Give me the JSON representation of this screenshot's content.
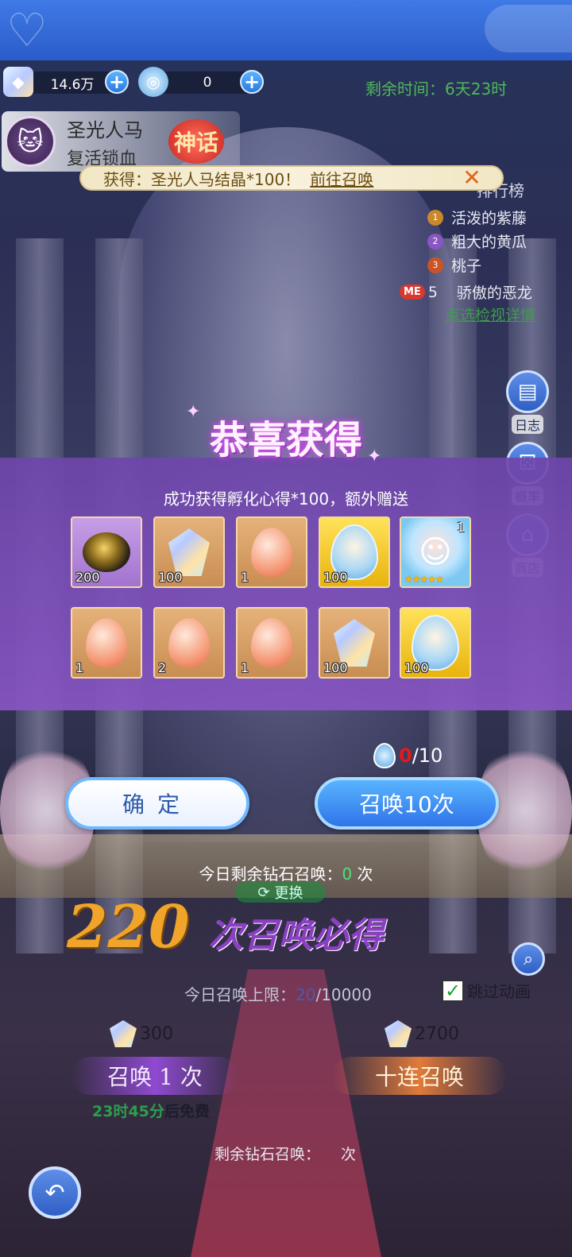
{
  "currency": {
    "diamonds": "14.6万",
    "eggs": "0"
  },
  "remaining_time": "剩余时间：6天23时",
  "character": {
    "name": "圣光人马",
    "skill": "复活锁血",
    "rarity": "神话"
  },
  "notification": {
    "text": "获得：圣光人马结晶*100！",
    "link": "前往召唤"
  },
  "ranking": {
    "title": "排行榜",
    "entries": [
      {
        "rank": "1",
        "name": "活泼的紫藤",
        "color": "#c9892a"
      },
      {
        "rank": "2",
        "name": "粗大的黄瓜",
        "color": "#8a56c4"
      },
      {
        "rank": "3",
        "name": "桃子",
        "color": "#c9542a"
      }
    ],
    "me_label": "ME",
    "me_rank": "5",
    "me_name": "骄傲的恶龙",
    "detail_link": "点选检视详情"
  },
  "side_buttons": [
    {
      "label": "日志",
      "icon": "log-icon"
    },
    {
      "label": "概率",
      "icon": "dice-icon"
    },
    {
      "label": "商店",
      "icon": "shop-icon"
    }
  ],
  "modal": {
    "title": "恭喜获得",
    "subtitle": "成功获得孵化心得*100，额外赠送",
    "items_row1": [
      {
        "type": "dark-gem",
        "qty": "200",
        "bg": "purple"
      },
      {
        "type": "crystal",
        "qty": "100",
        "bg": "orange"
      },
      {
        "type": "egg",
        "qty": "1",
        "bg": "orange"
      },
      {
        "type": "blue-egg",
        "qty": "100",
        "bg": "gold"
      },
      {
        "type": "character",
        "qty": "1",
        "stars": "★★★★★",
        "bg": "rainbow"
      }
    ],
    "items_row2": [
      {
        "type": "egg",
        "qty": "1",
        "bg": "orange"
      },
      {
        "type": "egg",
        "qty": "2",
        "bg": "orange"
      },
      {
        "type": "egg",
        "qty": "1",
        "bg": "orange"
      },
      {
        "type": "crystal",
        "qty": "100",
        "bg": "orange"
      },
      {
        "type": "blue-egg",
        "qty": "100",
        "bg": "gold"
      }
    ],
    "summon_have": "0",
    "summon_need": "/10",
    "confirm_label": "确定",
    "summon10_label": "召唤10次",
    "today_remaining_prefix": "今日剩余钻石召唤：",
    "today_remaining_value": "0",
    "today_remaining_suffix": " 次"
  },
  "screen": {
    "change_label": "更换",
    "guarantee_num": "220",
    "guarantee_text": "次召唤必得",
    "daily_limit_prefix": "今日召唤上限：",
    "daily_limit_current": "20",
    "daily_limit_total": "/10000",
    "skip_label": "跳过动画",
    "cost_once": "300",
    "cost_ten": "2700",
    "summon_once_label": "召唤 1 次",
    "summon_ten_label": "十连召唤",
    "free_timer": "23时45分",
    "free_suffix": "后免费",
    "remain_diamond_label": "剩余钻石召唤：",
    "remain_diamond_suffix": "次"
  }
}
